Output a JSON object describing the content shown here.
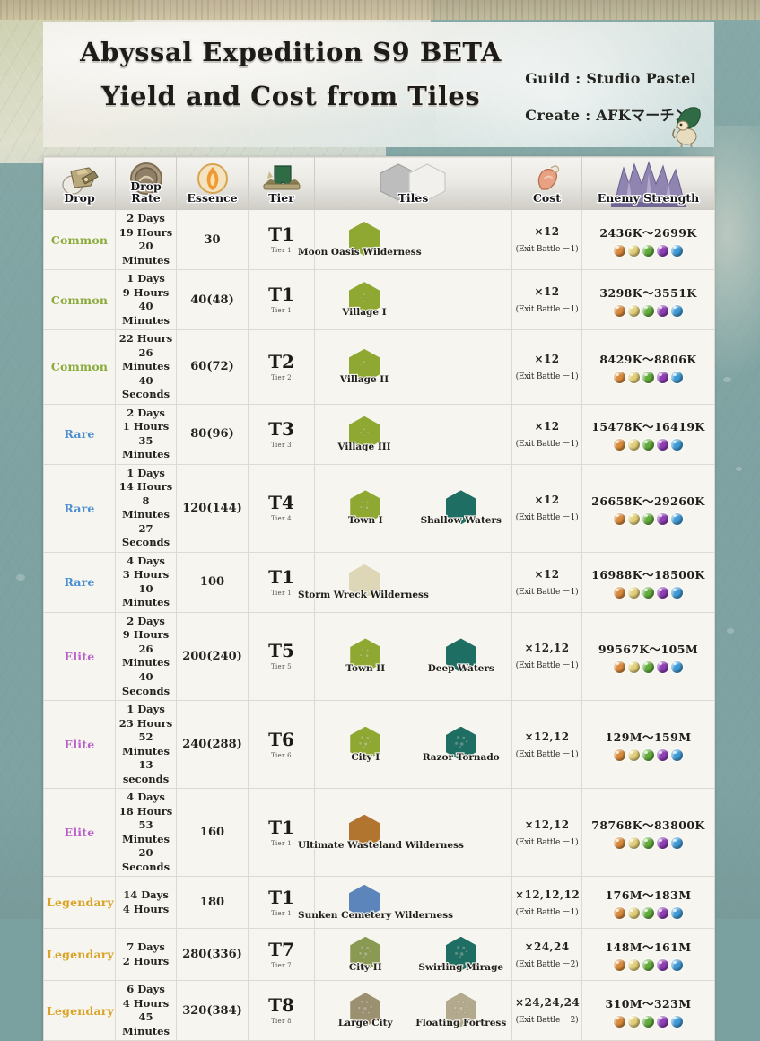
{
  "header": {
    "title_line1": "Abyssal Expedition S9 BETA",
    "title_line2": "Yield and Cost from Tiles",
    "guild_label": "Guild : Studio Pastel",
    "create_label": "Create : AFKマーチン"
  },
  "colors": {
    "common": "#8aab3c",
    "rare": "#4b8fd0",
    "elite": "#b862c9",
    "legendary": "#d9a327",
    "banner_bg": "#e9e7dd",
    "table_bg": "#f6f5ef",
    "map_water": "#81a6a4",
    "orb_fire": "#d98a3c",
    "orb_light": "#e3cf7a",
    "orb_nature": "#63ab3c",
    "orb_arcane": "#8e3fb5",
    "orb_water": "#3f9ad6"
  },
  "table": {
    "columns": [
      {
        "key": "drop",
        "label": "Drop",
        "icon": "treasure-chest-icon"
      },
      {
        "key": "rate",
        "label": "Drop\nRate",
        "icon": "drop-rate-coin-icon"
      },
      {
        "key": "essence",
        "label": "Essence",
        "icon": "essence-flame-icon"
      },
      {
        "key": "tier",
        "label": "Tier",
        "icon": "tier-banner-icon"
      },
      {
        "key": "tiles",
        "label": "Tiles",
        "icon": "hex-tiles-icon"
      },
      {
        "key": "cost",
        "label": "Cost",
        "icon": "meat-cost-icon"
      },
      {
        "key": "enemy",
        "label": "Enemy Strength",
        "icon": "fortress-icon"
      }
    ],
    "rows": [
      {
        "drop": "Common",
        "rarity": "common",
        "rate": "2 Days\n19 Hours\n20 Minutes",
        "essence": "30",
        "tier_main": "T1",
        "tier_sub": "Tier 1",
        "tiles": [
          {
            "name": "Moon Oasis Wilderness",
            "color": "#8fa832",
            "kind": "plain",
            "wide": true
          }
        ],
        "cost_main": "×12",
        "cost_sub": "(Exit Battle －1)",
        "enemy": "2436K〜2699K"
      },
      {
        "drop": "Common",
        "rarity": "common",
        "rate": "1 Days\n9 Hours\n40 Minutes",
        "essence": "40(48)",
        "tier_main": "T1",
        "tier_sub": "Tier 1",
        "tiles": [
          {
            "name": "Village I",
            "color": "#8fa832",
            "kind": "village",
            "wide": false
          }
        ],
        "cost_main": "×12",
        "cost_sub": "(Exit Battle －1)",
        "enemy": "3298K〜3551K"
      },
      {
        "drop": "Common",
        "rarity": "common",
        "rate": "22 Hours\n26 Minutes\n40 Seconds",
        "essence": "60(72)",
        "tier_main": "T2",
        "tier_sub": "Tier 2",
        "tiles": [
          {
            "name": "Village II",
            "color": "#8fa832",
            "kind": "village",
            "wide": false
          }
        ],
        "cost_main": "×12",
        "cost_sub": "(Exit Battle －1)",
        "enemy": "8429K〜8806K"
      },
      {
        "drop": "Rare",
        "rarity": "rare",
        "rate": "2 Days\n1 Hours\n35 Minutes",
        "essence": "80(96)",
        "tier_main": "T3",
        "tier_sub": "Tier 3",
        "tiles": [
          {
            "name": "Village III",
            "color": "#8fa832",
            "kind": "village",
            "wide": false
          }
        ],
        "cost_main": "×12",
        "cost_sub": "(Exit Battle －1)",
        "enemy": "15478K〜16419K"
      },
      {
        "drop": "Rare",
        "rarity": "rare",
        "rate": "1 Days\n14 Hours\n8 Minutes\n27 Seconds",
        "essence": "120(144)",
        "tier_main": "T4",
        "tier_sub": "Tier 4",
        "tiles": [
          {
            "name": "Town I",
            "color": "#8fa832",
            "kind": "town",
            "wide": false
          },
          {
            "name": "Shallow Waters",
            "color": "#1f6e63",
            "kind": "plain",
            "wide": false
          }
        ],
        "cost_main": "×12",
        "cost_sub": "(Exit Battle －1)",
        "enemy": "26658K〜29260K"
      },
      {
        "drop": "Rare",
        "rarity": "rare",
        "rate": "4 Days\n3 Hours\n10 Minutes",
        "essence": "100",
        "tier_main": "T1",
        "tier_sub": "Tier 1",
        "tiles": [
          {
            "name": "Storm Wreck Wilderness",
            "color": "#ddd7b8",
            "kind": "plain",
            "wide": true
          }
        ],
        "cost_main": "×12",
        "cost_sub": "(Exit Battle －1)",
        "enemy": "16988K〜18500K"
      },
      {
        "drop": "Elite",
        "rarity": "elite",
        "rate": "2 Days\n9 Hours\n26 Minutes\n40 Seconds",
        "essence": "200(240)",
        "tier_main": "T5",
        "tier_sub": "Tier 5",
        "tiles": [
          {
            "name": "Town II",
            "color": "#8fa832",
            "kind": "town",
            "wide": false
          },
          {
            "name": "Deep Waters",
            "color": "#1f6e63",
            "kind": "plain",
            "wide": false
          }
        ],
        "cost_main": "×12,12",
        "cost_sub": "(Exit Battle －1)",
        "enemy": "99567K〜105M"
      },
      {
        "drop": "Elite",
        "rarity": "elite",
        "rate": "1 Days\n23 Hours\n52 Minutes\n13 seconds",
        "essence": "240(288)",
        "tier_main": "T6",
        "tier_sub": "Tier 6",
        "tiles": [
          {
            "name": "City I",
            "color": "#8fa832",
            "kind": "city",
            "wide": false
          },
          {
            "name": "Razor Tornado",
            "color": "#1f6e63",
            "kind": "city",
            "wide": false
          }
        ],
        "cost_main": "×12,12",
        "cost_sub": "(Exit Battle －1)",
        "enemy": "129M〜159M"
      },
      {
        "drop": "Elite",
        "rarity": "elite",
        "rate": "4 Days\n18 Hours\n53 Minutes\n20 Seconds",
        "essence": "160",
        "tier_main": "T1",
        "tier_sub": "Tier 1",
        "tiles": [
          {
            "name": "Ultimate Wasteland Wilderness",
            "color": "#b2752f",
            "kind": "plain",
            "wide": true
          }
        ],
        "cost_main": "×12,12",
        "cost_sub": "(Exit Battle －1)",
        "enemy": "78768K〜83800K"
      },
      {
        "drop": "Legendary",
        "rarity": "legendary",
        "rate": "14 Days\n4 Hours",
        "essence": "180",
        "tier_main": "T1",
        "tier_sub": "Tier 1",
        "tiles": [
          {
            "name": "Sunken Cemetery Wilderness",
            "color": "#5b85bb",
            "kind": "plain",
            "wide": true
          }
        ],
        "cost_main": "×12,12,12",
        "cost_sub": "(Exit Battle －1)",
        "enemy": "176M〜183M"
      },
      {
        "drop": "Legendary",
        "rarity": "legendary",
        "rate": "7 Days\n2 Hours",
        "essence": "280(336)",
        "tier_main": "T7",
        "tier_sub": "Tier 7",
        "tiles": [
          {
            "name": "City II",
            "color": "#8a9a52",
            "kind": "city",
            "wide": false
          },
          {
            "name": "Swirling Mirage",
            "color": "#1f6e63",
            "kind": "city",
            "wide": false
          }
        ],
        "cost_main": "×24,24",
        "cost_sub": "(Exit Battle －2)",
        "enemy": "148M〜161M"
      },
      {
        "drop": "Legendary",
        "rarity": "legendary",
        "rate": "6 Days\n4 Hours\n45 Minutes",
        "essence": "320(384)",
        "tier_main": "T8",
        "tier_sub": "Tier 8",
        "tiles": [
          {
            "name": "Large City",
            "color": "#9b9070",
            "kind": "largecity",
            "wide": false
          },
          {
            "name": "Floating Fortress",
            "color": "#b3a98c",
            "kind": "largecity",
            "wide": false
          }
        ],
        "cost_main": "×24,24,24",
        "cost_sub": "(Exit Battle －2)",
        "enemy": "310M〜323M"
      }
    ],
    "orb_sequence": [
      "orb_fire",
      "orb_light",
      "orb_nature",
      "orb_arcane",
      "orb_water"
    ]
  }
}
